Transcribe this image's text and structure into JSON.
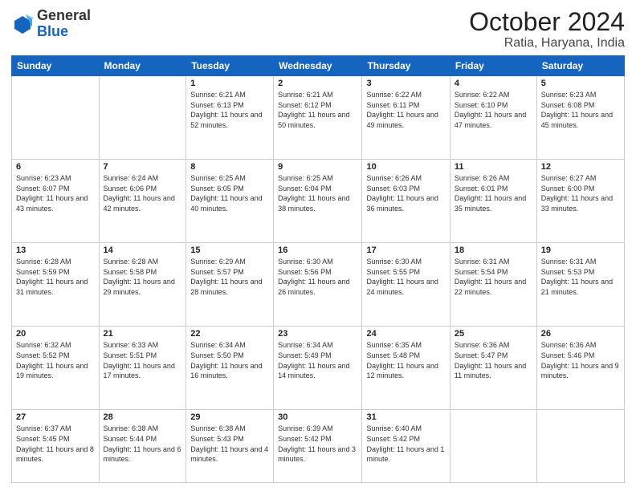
{
  "header": {
    "logo_general": "General",
    "logo_blue": "Blue",
    "month": "October 2024",
    "location": "Ratia, Haryana, India"
  },
  "weekdays": [
    "Sunday",
    "Monday",
    "Tuesday",
    "Wednesday",
    "Thursday",
    "Friday",
    "Saturday"
  ],
  "weeks": [
    [
      null,
      null,
      {
        "day": 1,
        "sunrise": "6:21 AM",
        "sunset": "6:13 PM",
        "daylight": "11 hours and 52 minutes."
      },
      {
        "day": 2,
        "sunrise": "6:21 AM",
        "sunset": "6:12 PM",
        "daylight": "11 hours and 50 minutes."
      },
      {
        "day": 3,
        "sunrise": "6:22 AM",
        "sunset": "6:11 PM",
        "daylight": "11 hours and 49 minutes."
      },
      {
        "day": 4,
        "sunrise": "6:22 AM",
        "sunset": "6:10 PM",
        "daylight": "11 hours and 47 minutes."
      },
      {
        "day": 5,
        "sunrise": "6:23 AM",
        "sunset": "6:08 PM",
        "daylight": "11 hours and 45 minutes."
      }
    ],
    [
      {
        "day": 6,
        "sunrise": "6:23 AM",
        "sunset": "6:07 PM",
        "daylight": "11 hours and 43 minutes."
      },
      {
        "day": 7,
        "sunrise": "6:24 AM",
        "sunset": "6:06 PM",
        "daylight": "11 hours and 42 minutes."
      },
      {
        "day": 8,
        "sunrise": "6:25 AM",
        "sunset": "6:05 PM",
        "daylight": "11 hours and 40 minutes."
      },
      {
        "day": 9,
        "sunrise": "6:25 AM",
        "sunset": "6:04 PM",
        "daylight": "11 hours and 38 minutes."
      },
      {
        "day": 10,
        "sunrise": "6:26 AM",
        "sunset": "6:03 PM",
        "daylight": "11 hours and 36 minutes."
      },
      {
        "day": 11,
        "sunrise": "6:26 AM",
        "sunset": "6:01 PM",
        "daylight": "11 hours and 35 minutes."
      },
      {
        "day": 12,
        "sunrise": "6:27 AM",
        "sunset": "6:00 PM",
        "daylight": "11 hours and 33 minutes."
      }
    ],
    [
      {
        "day": 13,
        "sunrise": "6:28 AM",
        "sunset": "5:59 PM",
        "daylight": "11 hours and 31 minutes."
      },
      {
        "day": 14,
        "sunrise": "6:28 AM",
        "sunset": "5:58 PM",
        "daylight": "11 hours and 29 minutes."
      },
      {
        "day": 15,
        "sunrise": "6:29 AM",
        "sunset": "5:57 PM",
        "daylight": "11 hours and 28 minutes."
      },
      {
        "day": 16,
        "sunrise": "6:30 AM",
        "sunset": "5:56 PM",
        "daylight": "11 hours and 26 minutes."
      },
      {
        "day": 17,
        "sunrise": "6:30 AM",
        "sunset": "5:55 PM",
        "daylight": "11 hours and 24 minutes."
      },
      {
        "day": 18,
        "sunrise": "6:31 AM",
        "sunset": "5:54 PM",
        "daylight": "11 hours and 22 minutes."
      },
      {
        "day": 19,
        "sunrise": "6:31 AM",
        "sunset": "5:53 PM",
        "daylight": "11 hours and 21 minutes."
      }
    ],
    [
      {
        "day": 20,
        "sunrise": "6:32 AM",
        "sunset": "5:52 PM",
        "daylight": "11 hours and 19 minutes."
      },
      {
        "day": 21,
        "sunrise": "6:33 AM",
        "sunset": "5:51 PM",
        "daylight": "11 hours and 17 minutes."
      },
      {
        "day": 22,
        "sunrise": "6:34 AM",
        "sunset": "5:50 PM",
        "daylight": "11 hours and 16 minutes."
      },
      {
        "day": 23,
        "sunrise": "6:34 AM",
        "sunset": "5:49 PM",
        "daylight": "11 hours and 14 minutes."
      },
      {
        "day": 24,
        "sunrise": "6:35 AM",
        "sunset": "5:48 PM",
        "daylight": "11 hours and 12 minutes."
      },
      {
        "day": 25,
        "sunrise": "6:36 AM",
        "sunset": "5:47 PM",
        "daylight": "11 hours and 11 minutes."
      },
      {
        "day": 26,
        "sunrise": "6:36 AM",
        "sunset": "5:46 PM",
        "daylight": "11 hours and 9 minutes."
      }
    ],
    [
      {
        "day": 27,
        "sunrise": "6:37 AM",
        "sunset": "5:45 PM",
        "daylight": "11 hours and 8 minutes."
      },
      {
        "day": 28,
        "sunrise": "6:38 AM",
        "sunset": "5:44 PM",
        "daylight": "11 hours and 6 minutes."
      },
      {
        "day": 29,
        "sunrise": "6:38 AM",
        "sunset": "5:43 PM",
        "daylight": "11 hours and 4 minutes."
      },
      {
        "day": 30,
        "sunrise": "6:39 AM",
        "sunset": "5:42 PM",
        "daylight": "11 hours and 3 minutes."
      },
      {
        "day": 31,
        "sunrise": "6:40 AM",
        "sunset": "5:42 PM",
        "daylight": "11 hours and 1 minute."
      },
      null,
      null
    ]
  ]
}
